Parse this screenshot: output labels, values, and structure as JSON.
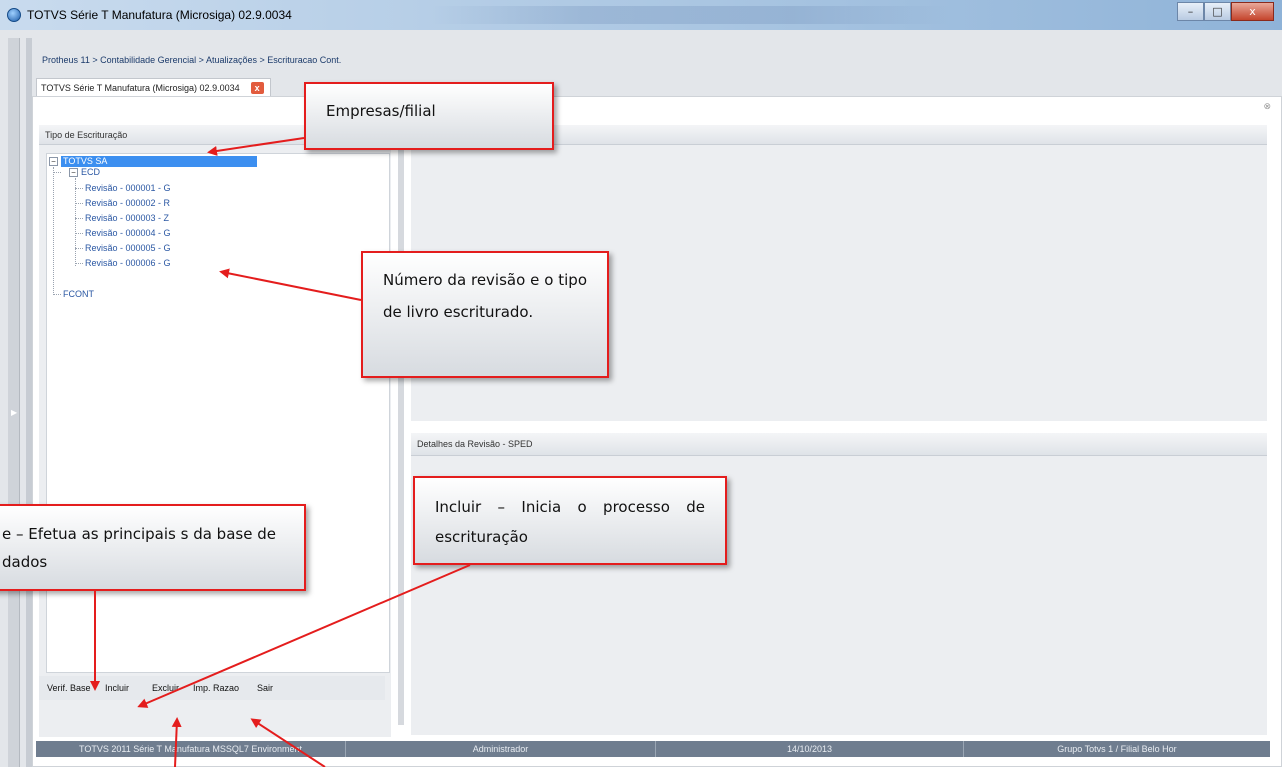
{
  "window": {
    "title": "TOTVS Série T Manufatura (Microsiga) 02.9.0034",
    "minimize_glyph": "–",
    "maximize_glyph": "□",
    "close_glyph": "x"
  },
  "breadcrumb": "Protheus 11 > Contabilidade Gerencial > Atualizações > Escrituracao Cont.",
  "tab": {
    "label": "TOTVS Série T Manufatura (Microsiga) 02.9.0034",
    "close_glyph": "x"
  },
  "left_panel": {
    "title": "Tipo de Escrituração",
    "tree": {
      "root": "TOTVS SA",
      "groups": [
        {
          "label": "ECD",
          "items": [
            "Revisão - 000001 - G",
            "Revisão - 000002 - R",
            "Revisão - 000003 - Z",
            "Revisão - 000004 - G",
            "Revisão - 000005 - G",
            "Revisão - 000006 - G"
          ]
        },
        {
          "label": "FCONT",
          "items": []
        }
      ]
    },
    "buttons": {
      "verif_base": "Verif. Base",
      "incluir": "Incluir",
      "excluir": "Excluir",
      "imp_razao": "Imp. Razao",
      "sair": "Sair"
    }
  },
  "right_panel": {
    "details_title": "Detalhes da Revisão - SPED"
  },
  "status_bar": [
    "TOTVS 2011 Série T Manufatura MSSQL7 Environment",
    "Administrador",
    "14/10/2013",
    "Grupo Totvs 1 / Filial Belo Hor"
  ],
  "callouts": {
    "empresas": "Empresas/filial",
    "revisao": "Número da revisão e o tipo de livro escriturado.",
    "verif": "e – Efetua as principais s da base de dados",
    "incluir": "Incluir – Inicia o processo de escrituração"
  },
  "icons": {
    "app_icon": "totvs-globe-icon",
    "expander": "minus-box-icon"
  },
  "colors": {
    "callout_border": "#e41d1d",
    "selection": "#3c8ff0",
    "statusbar": "#6f7d8f"
  }
}
